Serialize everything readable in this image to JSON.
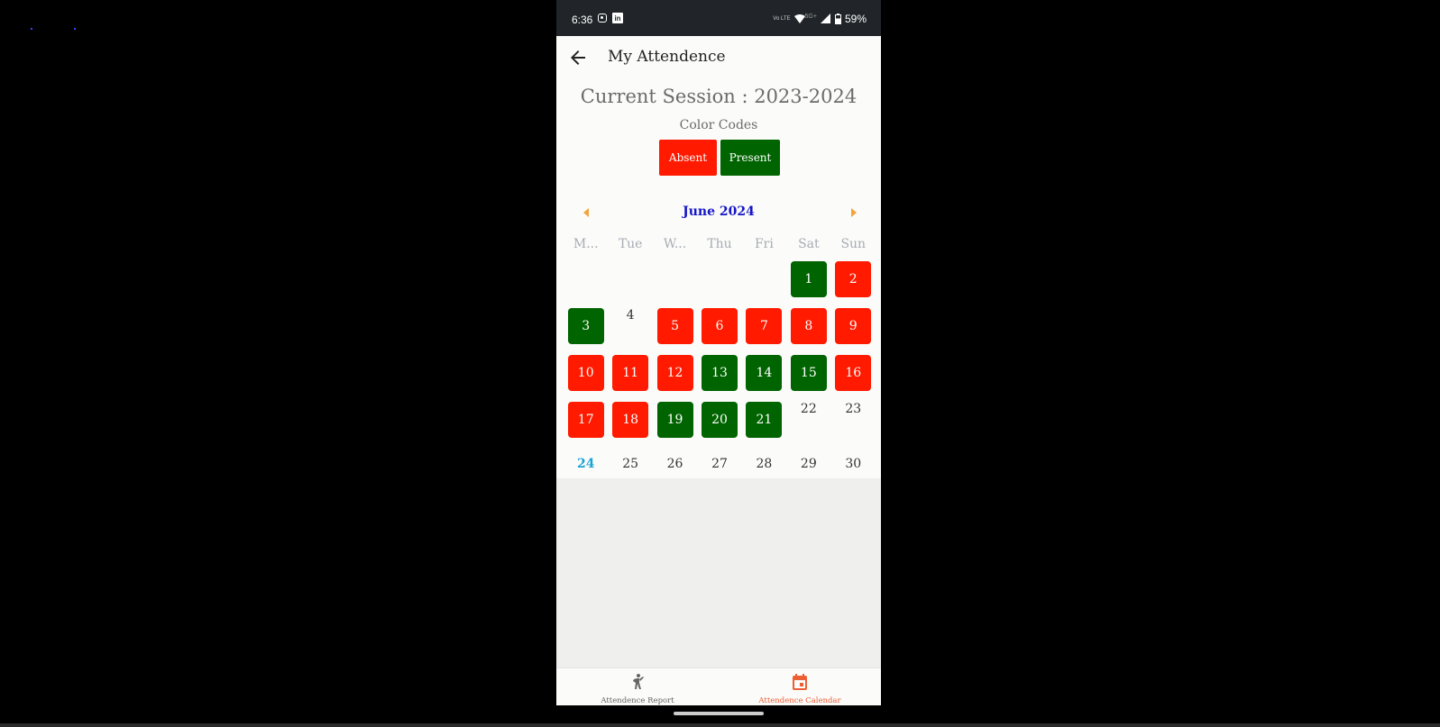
{
  "status_bar": {
    "time": "6:36",
    "battery": "59%",
    "volte": "Vo LTE",
    "network": "5G+"
  },
  "app_bar": {
    "title": "My Attendence",
    "back_icon": "arrow-left-icon"
  },
  "session": {
    "text": "Current Session : 2023-2024"
  },
  "color_codes": {
    "label": "Color Codes",
    "absent": "Absent",
    "present": "Present",
    "absent_color": "#ff1a00",
    "present_color": "#006400"
  },
  "calendar": {
    "month": "June 2024",
    "weekdays": [
      "M...",
      "Tue",
      "W...",
      "Thu",
      "Fri",
      "Sat",
      "Sun"
    ],
    "first_weekday_index": 5,
    "days": [
      {
        "d": "1",
        "status": "present"
      },
      {
        "d": "2",
        "status": "absent"
      },
      {
        "d": "3",
        "status": "present"
      },
      {
        "d": "4",
        "status": "none"
      },
      {
        "d": "5",
        "status": "absent"
      },
      {
        "d": "6",
        "status": "absent"
      },
      {
        "d": "7",
        "status": "absent"
      },
      {
        "d": "8",
        "status": "absent"
      },
      {
        "d": "9",
        "status": "absent"
      },
      {
        "d": "10",
        "status": "absent"
      },
      {
        "d": "11",
        "status": "absent"
      },
      {
        "d": "12",
        "status": "absent"
      },
      {
        "d": "13",
        "status": "present"
      },
      {
        "d": "14",
        "status": "present"
      },
      {
        "d": "15",
        "status": "present"
      },
      {
        "d": "16",
        "status": "absent"
      },
      {
        "d": "17",
        "status": "absent"
      },
      {
        "d": "18",
        "status": "absent"
      },
      {
        "d": "19",
        "status": "present"
      },
      {
        "d": "20",
        "status": "present"
      },
      {
        "d": "21",
        "status": "present"
      },
      {
        "d": "22",
        "status": "none"
      },
      {
        "d": "23",
        "status": "none"
      },
      {
        "d": "24",
        "status": "today"
      },
      {
        "d": "25",
        "status": "future"
      },
      {
        "d": "26",
        "status": "future"
      },
      {
        "d": "27",
        "status": "future"
      },
      {
        "d": "28",
        "status": "future"
      },
      {
        "d": "29",
        "status": "future"
      },
      {
        "d": "30",
        "status": "future"
      }
    ]
  },
  "bottom_nav": {
    "report_label": "Attendence Report",
    "report_icon": "person-walking-icon",
    "calendar_label": "Attendence Calendar",
    "calendar_icon": "calendar-icon",
    "active": "calendar",
    "active_color": "#ee5e35"
  }
}
